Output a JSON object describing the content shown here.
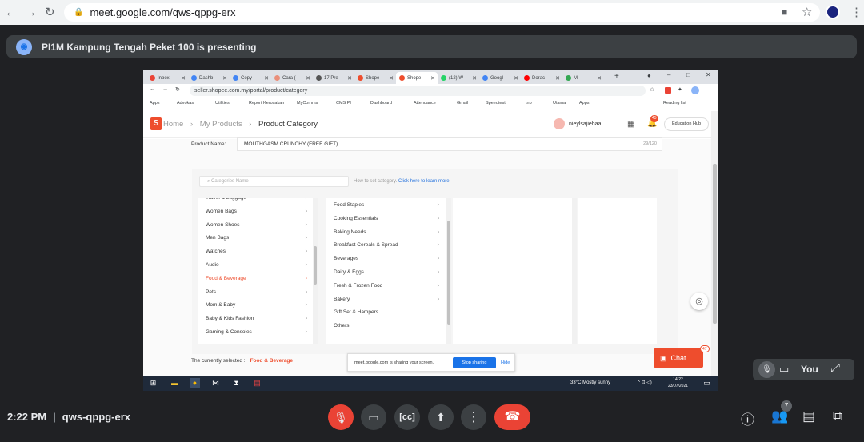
{
  "browser": {
    "url": "meet.google.com/qws-qppg-erx"
  },
  "banner": {
    "text": "PI1M Kampung Tengah Peket 100 is presenting"
  },
  "inner_browser": {
    "tabs": [
      {
        "label": "Inbox",
        "color": "#ea4335"
      },
      {
        "label": "Dashb",
        "color": "#4285f4"
      },
      {
        "label": "Copy",
        "color": "#4285f4"
      },
      {
        "label": "Cara (",
        "color": "#ea8f7a"
      },
      {
        "label": "17 Pre",
        "color": "#555555"
      },
      {
        "label": "Shope",
        "color": "#ee4d2d"
      },
      {
        "label": "Shope",
        "color": "#ee4d2d",
        "active": true
      },
      {
        "label": "(12) W",
        "color": "#25d366"
      },
      {
        "label": "Googl",
        "color": "#4285f4"
      },
      {
        "label": "Dorac",
        "color": "#ff0000"
      },
      {
        "label": "M",
        "color": "#34a853"
      }
    ],
    "url": "seller.shopee.com.my/portal/product/category",
    "bookmarks": [
      "Apps",
      "Advokasi",
      "Utilities",
      "Report Kerosakan",
      "MyComms",
      "CMS PI",
      "Dashboard",
      "Attendance",
      "Gmail",
      "Speedtest",
      "tnb",
      "Utama",
      "Apps"
    ],
    "reading_list": "Reading list"
  },
  "shopee": {
    "breadcrumb": {
      "home": "Home",
      "products": "My Products",
      "current": "Product Category"
    },
    "username": "nieylsajiehaa",
    "notification_count": "45",
    "education_hub": "Education Hub",
    "product_name_label": "Product Name:",
    "product_name_value": "MOUTHGASM CRUNCHY (FREE GIFT)",
    "char_count": "29/120",
    "category_search_placeholder": "Categories Name",
    "hint_text": "How to set category.",
    "hint_link": "Click here to learn more",
    "categories_l1": [
      {
        "label": "Travel & Luggage"
      },
      {
        "label": "Women Bags"
      },
      {
        "label": "Women Shoes"
      },
      {
        "label": "Men Bags"
      },
      {
        "label": "Watches"
      },
      {
        "label": "Audio"
      },
      {
        "label": "Food & Beverage",
        "selected": true
      },
      {
        "label": "Pets"
      },
      {
        "label": "Mom & Baby"
      },
      {
        "label": "Baby & Kids Fashion"
      },
      {
        "label": "Gaming & Consoles"
      }
    ],
    "categories_l2": [
      {
        "label": "Food Staples",
        "arrow": true
      },
      {
        "label": "Cooking Essentials",
        "arrow": true
      },
      {
        "label": "Baking Needs",
        "arrow": true
      },
      {
        "label": "Breakfast Cereals & Spread",
        "arrow": true
      },
      {
        "label": "Beverages",
        "arrow": true
      },
      {
        "label": "Dairy & Eggs",
        "arrow": true
      },
      {
        "label": "Fresh & Frozen Food",
        "arrow": true
      },
      {
        "label": "Bakery",
        "arrow": true
      },
      {
        "label": "Gift Set & Hampers",
        "arrow": false
      },
      {
        "label": "Others",
        "arrow": false
      }
    ],
    "selected_label": "The currently selected :",
    "selected_value": "Food & Beverage",
    "chat_label": "Chat",
    "chat_badge": "47"
  },
  "share_bar": {
    "message": "meet.google.com is sharing your screen.",
    "stop": "Stop sharing",
    "hide": "Hide"
  },
  "taskbar": {
    "weather": "33°C  Mostly sunny",
    "time": "14:22",
    "date": "23/07/2021"
  },
  "self_tile": {
    "label": "You"
  },
  "meeting": {
    "time": "2:22 PM",
    "code": "qws-qppg-erx",
    "people_count": "7"
  }
}
